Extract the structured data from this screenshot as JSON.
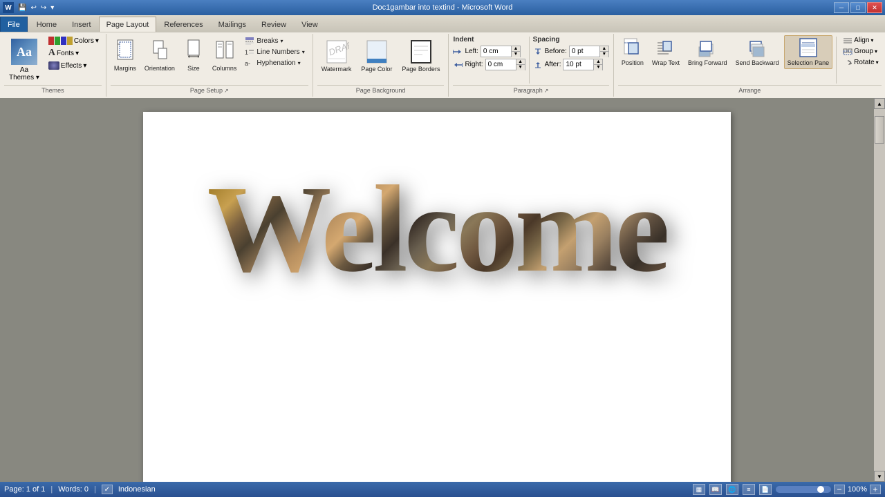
{
  "window": {
    "title": "Doc1gambar into textind - Microsoft Word",
    "minimize": "─",
    "restore": "□",
    "close": "✕"
  },
  "quickaccess": {
    "save": "💾",
    "undo": "↩",
    "redo": "↪"
  },
  "tabs": {
    "file": "File",
    "home": "Home",
    "insert": "Insert",
    "pagelayout": "Page Layout",
    "references": "References",
    "mailings": "Mailings",
    "review": "Review",
    "view": "View"
  },
  "ribbon": {
    "themes_label": "Themes",
    "themes_btn": "Aa",
    "colors_label": "Colors",
    "fonts_label": "Fonts",
    "effects_label": "Effects",
    "themes_group_label": "Themes",
    "margins_label": "Margins",
    "orientation_label": "Orientation",
    "size_label": "Size",
    "columns_label": "Columns",
    "breaks_label": "Breaks",
    "linenumbers_label": "Line Numbers",
    "hyphenation_label": "Hyphenation",
    "pagesetup_label": "Page Setup",
    "watermark_label": "Watermark",
    "pagecolor_label": "Page Color",
    "pageborders_label": "Page Borders",
    "pagebg_label": "Page Background",
    "indent_label": "Indent",
    "left_label": "Left:",
    "left_val": "0 cm",
    "right_label": "Right:",
    "right_val": "0 cm",
    "spacing_label": "Spacing",
    "before_label": "Before:",
    "before_val": "0 pt",
    "after_label": "After:",
    "after_val": "10 pt",
    "paragraph_label": "Paragraph",
    "position_label": "Position",
    "wraptext_label": "Wrap Text",
    "bringforward_label": "Bring Forward",
    "sendbackward_label": "Send Backward",
    "selectionpane_label": "Selection Pane",
    "align_label": "Align",
    "group_label": "Group",
    "rotate_label": "Rotate",
    "arrange_label": "Arrange"
  },
  "statusbar": {
    "page": "Page: 1 of 1",
    "words": "Words: 0",
    "language": "Indonesian",
    "zoom": "100%"
  },
  "document": {
    "welcome_text": "Welcome"
  }
}
